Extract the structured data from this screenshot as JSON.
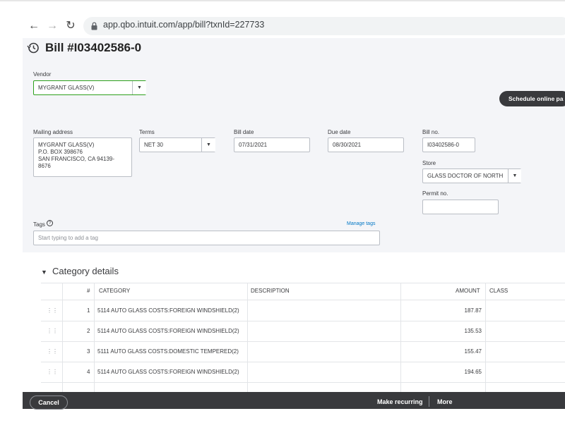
{
  "browser": {
    "url": "app.qbo.intuit.com/app/bill?txnId=227733"
  },
  "header": {
    "title": "Bill #I03402586-0"
  },
  "form": {
    "vendor_label": "Vendor",
    "vendor_value": "MYGRANT GLASS(V)",
    "mailing_label": "Mailing address",
    "mailing_lines": [
      "MYGRANT GLASS(V)",
      "P.O. BOX 398676",
      "SAN FRANCISCO, CA  94139-",
      "8676"
    ],
    "terms_label": "Terms",
    "terms_value": "NET 30",
    "bill_date_label": "Bill date",
    "bill_date_value": "07/31/2021",
    "due_date_label": "Due date",
    "due_date_value": "08/30/2021",
    "bill_no_label": "Bill no.",
    "bill_no_value": "I03402586-0",
    "store_label": "Store",
    "store_value": "GLASS DOCTOR OF NORTH",
    "permit_label": "Permit no.",
    "permit_value": "",
    "tags_label": "Tags",
    "tags_placeholder": "Start typing to add a tag",
    "manage_tags": "Manage tags",
    "schedule_label": "Schedule online pa"
  },
  "category": {
    "title": "Category details",
    "headers": {
      "num": "#",
      "category": "CATEGORY",
      "description": "DESCRIPTION",
      "amount": "AMOUNT",
      "class": "CLASS"
    },
    "rows": [
      {
        "num": "1",
        "category": "5114 AUTO GLASS COSTS:FOREIGN WINDSHIELD(2)",
        "amount": "187.87"
      },
      {
        "num": "2",
        "category": "5114 AUTO GLASS COSTS:FOREIGN WINDSHIELD(2)",
        "amount": "135.53"
      },
      {
        "num": "3",
        "category": "5111 AUTO GLASS COSTS:DOMESTIC TEMPERED(2)",
        "amount": "155.47"
      },
      {
        "num": "4",
        "category": "5114 AUTO GLASS COSTS:FOREIGN WINDSHIELD(2)",
        "amount": "194.65"
      }
    ]
  },
  "footer": {
    "cancel": "Cancel",
    "make_recurring": "Make recurring",
    "more": "More"
  }
}
